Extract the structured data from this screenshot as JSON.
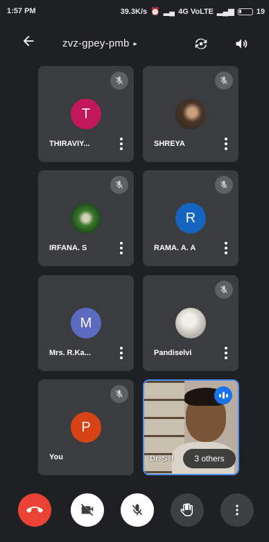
{
  "status": {
    "time": "1:57 PM",
    "network": "39.3K/s",
    "carrier": "4G VoLTE",
    "battery": "19"
  },
  "header": {
    "meeting_code": "zvz-gpey-pmb",
    "caret": "▸",
    "back_icon": "arrow-back-icon",
    "switch_camera_icon": "switch-camera-icon",
    "speaker_icon": "speaker-icon"
  },
  "participants": [
    {
      "name": "THIRAVIY...",
      "initial": "T",
      "color": "#c2185b",
      "muted": true
    },
    {
      "name": "SHREYA",
      "initial": "",
      "color": "#5b4636",
      "muted": true
    },
    {
      "name": "IRFANA. S",
      "initial": "",
      "color": "#2f6b2f",
      "muted": true
    },
    {
      "name": "RAMA. A. A",
      "initial": "R",
      "color": "#1565c0",
      "muted": true
    },
    {
      "name": "Mrs. R.Ka...",
      "initial": "M",
      "color": "#5c6bc0",
      "muted": false
    },
    {
      "name": "Pandiselvi",
      "initial": "",
      "color": "#c9c7c2",
      "muted": true
    },
    {
      "name": "You",
      "initial": "P",
      "color": "#d84315",
      "muted": true
    }
  ],
  "active_speaker": {
    "name": "Dr. S. I",
    "others_label": "3 others"
  },
  "controls": {
    "end_call_color": "#ea4335",
    "button_light": "#ffffff",
    "button_dark": "#3c4043"
  }
}
